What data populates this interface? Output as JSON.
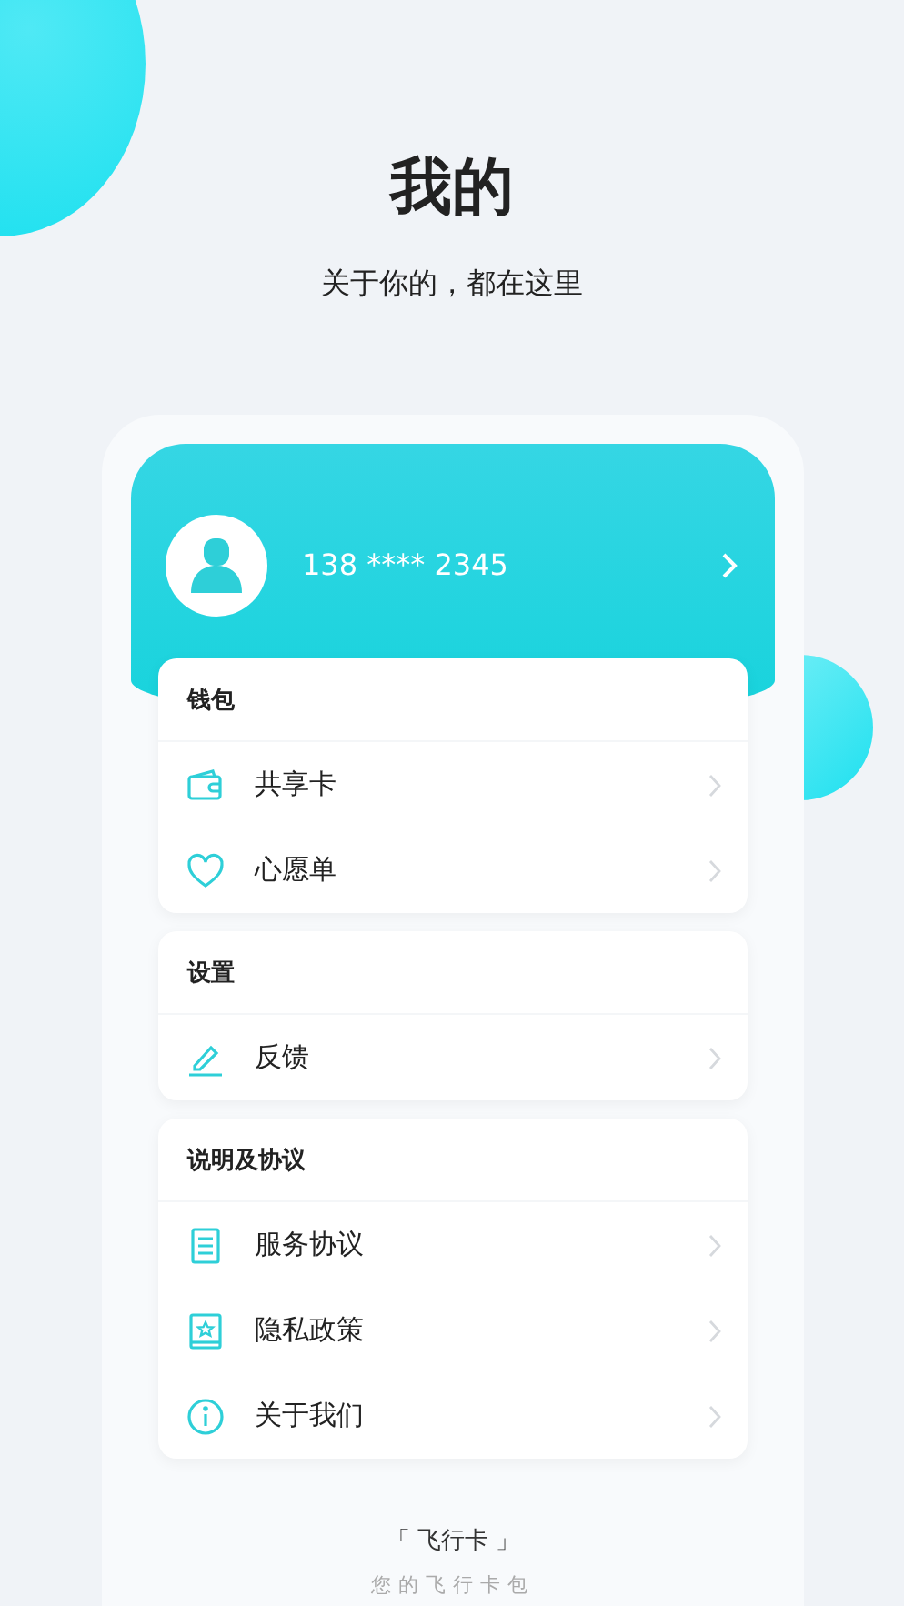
{
  "page": {
    "title": "我的",
    "subtitle": "关于你的，都在这里"
  },
  "profile": {
    "phone": "138 **** 2345"
  },
  "sections": [
    {
      "title": "钱包",
      "items": [
        {
          "label": "共享卡"
        },
        {
          "label": "心愿单"
        }
      ]
    },
    {
      "title": "设置",
      "items": [
        {
          "label": "反馈"
        }
      ]
    },
    {
      "title": "说明及协议",
      "items": [
        {
          "label": "服务协议"
        },
        {
          "label": "隐私政策"
        },
        {
          "label": "关于我们"
        }
      ]
    }
  ],
  "footer": {
    "brand": "「 飞行卡 」",
    "tagline": "您的飞行卡包"
  }
}
